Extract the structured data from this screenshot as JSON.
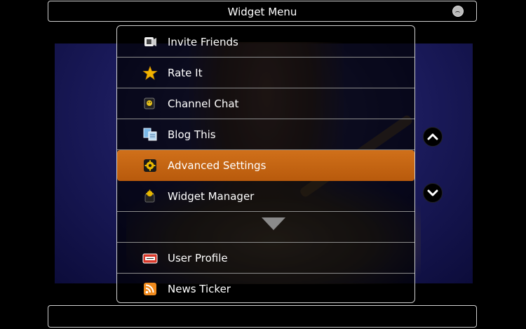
{
  "header": {
    "title": "Widget Menu"
  },
  "menu": {
    "items": [
      {
        "label": "Invite Friends",
        "icon": "invite-icon",
        "selected": false
      },
      {
        "label": "Rate It",
        "icon": "star-icon",
        "selected": false
      },
      {
        "label": "Channel Chat",
        "icon": "chat-icon",
        "selected": false
      },
      {
        "label": "Blog This",
        "icon": "blog-icon",
        "selected": false
      },
      {
        "label": "Advanced Settings",
        "icon": "gear-icon",
        "selected": true
      },
      {
        "label": "Widget Manager",
        "icon": "widget-manager-icon",
        "selected": false
      },
      {
        "label": "User Profile",
        "icon": "profile-card-icon",
        "selected": false
      },
      {
        "label": "News Ticker",
        "icon": "rss-icon",
        "selected": false
      }
    ]
  },
  "colors": {
    "selection": "#c8661a",
    "border": "#cfcfcf",
    "background": "#000000"
  }
}
